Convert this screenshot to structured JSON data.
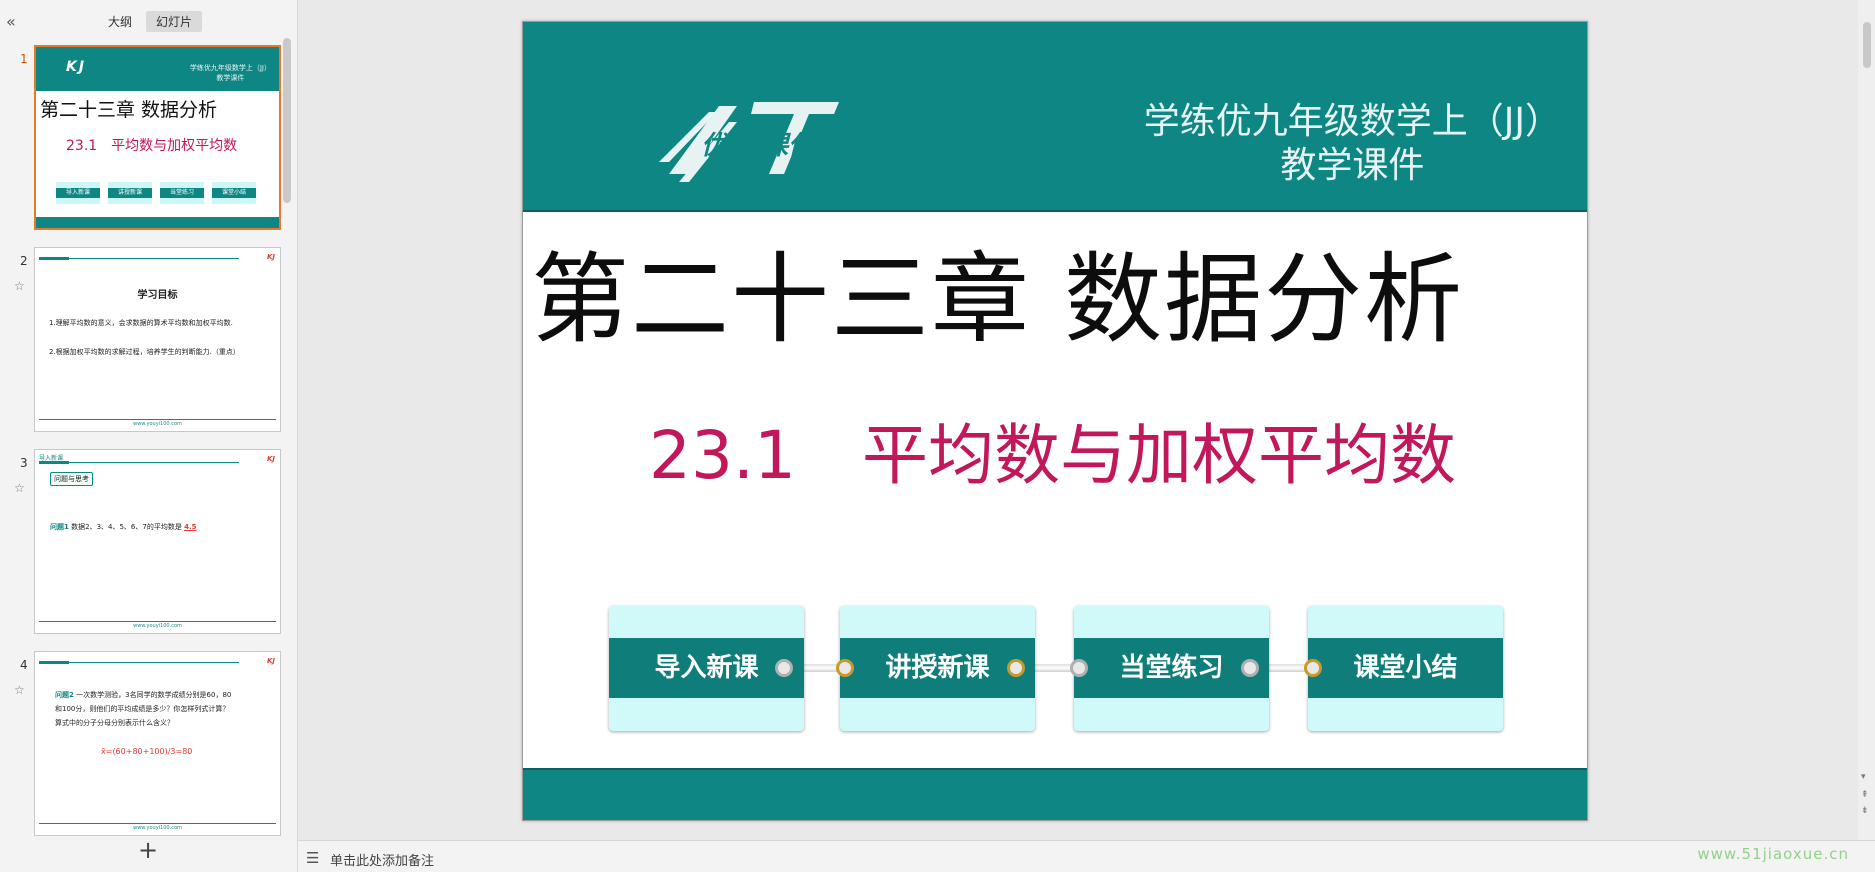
{
  "panel": {
    "collapse_icon": "«",
    "tabs": [
      {
        "label": "大纲",
        "active": false
      },
      {
        "label": "幻灯片",
        "active": true
      }
    ],
    "add_icon": "+"
  },
  "thumbnails": [
    {
      "number": "1",
      "header_line1": "学练优九年级数学上（JJ）",
      "header_line2": "教学课件",
      "logo": "KJ",
      "title": "第二十三章  数据分析",
      "subtitle": "23.1　平均数与加权平均数",
      "buttons": [
        "导入新课",
        "讲授新课",
        "当堂练习",
        "课堂小结"
      ]
    },
    {
      "number": "2",
      "star": "☆",
      "heading": "学习目标",
      "line1": "1.理解平均数的意义，会求数据的算术平均数和加权平均数.",
      "line2": "2.根据加权平均数的求解过程，培养学生的判断能力.（重点）",
      "url": "www.youyi100.com"
    },
    {
      "number": "3",
      "star": "☆",
      "section_tag": "导入新课",
      "label_box": "问题与思考",
      "q_label": "问题1",
      "q_text": "数据2、3、4、5、6、7的平均数是",
      "answer": "4.5",
      "url": "www.youyi100.com"
    },
    {
      "number": "4",
      "star": "☆",
      "q_label": "问题2",
      "line1": "一次数学测验，3名同学的数学成绩分别是60，80",
      "line2": "和100分，则他们的平均成绩是多少？你怎样列式计算？",
      "line3": "算式中的分子分母分别表示什么含义？",
      "formula": "x̄=(60+80+100)/3=80",
      "url": "www.youyi100.com"
    }
  ],
  "slide": {
    "logo_text": "优翼 课件",
    "header_line1": "学练优九年级数学上（JJ）",
    "header_line2": "教学课件",
    "title": "第二十三章  数据分析",
    "subtitle_num": "23.1",
    "subtitle_text": "平均数与加权平均数",
    "nav_buttons": [
      "导入新课",
      "讲授新课",
      "当堂练习",
      "课堂小结"
    ]
  },
  "notes": {
    "placeholder": "单击此处添加备注"
  },
  "watermark": "www.51jiaoxue.cn",
  "colors": {
    "teal": "#0e8784",
    "magenta": "#c2185b",
    "active_orange": "#e57a2a"
  }
}
